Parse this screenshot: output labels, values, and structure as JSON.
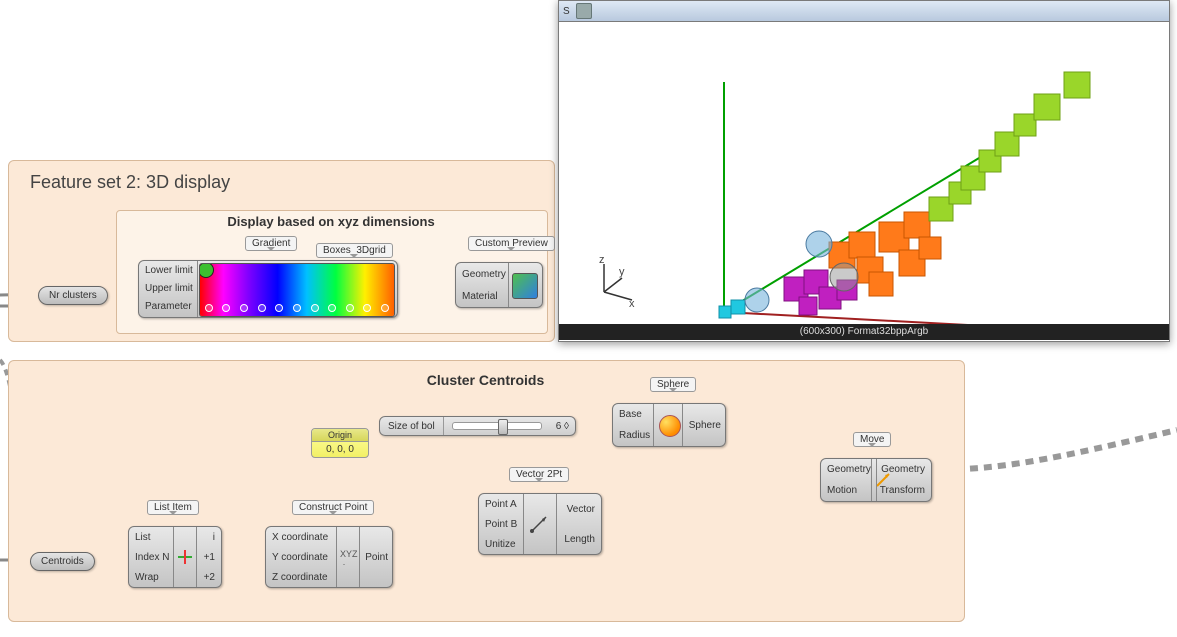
{
  "groups": {
    "feature2": {
      "title": "Feature set 2: 3D display"
    },
    "display_sub": {
      "title": "Display based on xyz dimensions"
    },
    "centroids": {
      "title": "Cluster Centroids"
    }
  },
  "params": {
    "nr_clusters": "Nr clusters",
    "centroids": "Centroids"
  },
  "tags": {
    "gradient": "Gradient",
    "boxes3d": "Boxes_3Dgrid",
    "custom_preview": "Custom Preview",
    "list_item": "List Item",
    "construct_point": "Construct Point",
    "vector2pt": "Vector 2Pt",
    "sphere": "Sphere",
    "move": "Move"
  },
  "components": {
    "gradient": {
      "in": [
        "Lower limit",
        "Upper limit",
        "Parameter"
      ]
    },
    "custom_preview": {
      "in": [
        "Geometry",
        "Material"
      ]
    },
    "list_item": {
      "in": [
        "List",
        "Index N",
        "Wrap"
      ],
      "out": [
        "i",
        "+1",
        "+2"
      ]
    },
    "construct_point": {
      "in": [
        "X coordinate",
        "Y coordinate",
        "Z coordinate"
      ],
      "out": "Point"
    },
    "vector2pt": {
      "in": [
        "Point A",
        "Point B",
        "Unitize"
      ],
      "out": [
        "Vector",
        "Length"
      ]
    },
    "sphere": {
      "in": [
        "Base",
        "Radius"
      ],
      "out": "Sphere"
    },
    "move": {
      "in": [
        "Geometry",
        "Motion"
      ],
      "out": [
        "Geometry",
        "Transform"
      ]
    }
  },
  "panel": {
    "origin": {
      "title": "Origin",
      "body": "0, 0, 0"
    }
  },
  "slider": {
    "label": "Size of bol",
    "value": "6"
  },
  "preview": {
    "title": "S",
    "footer": "(600x300) Format32bppArgb",
    "axes": {
      "x": "x",
      "y": "y",
      "z": "z"
    }
  }
}
